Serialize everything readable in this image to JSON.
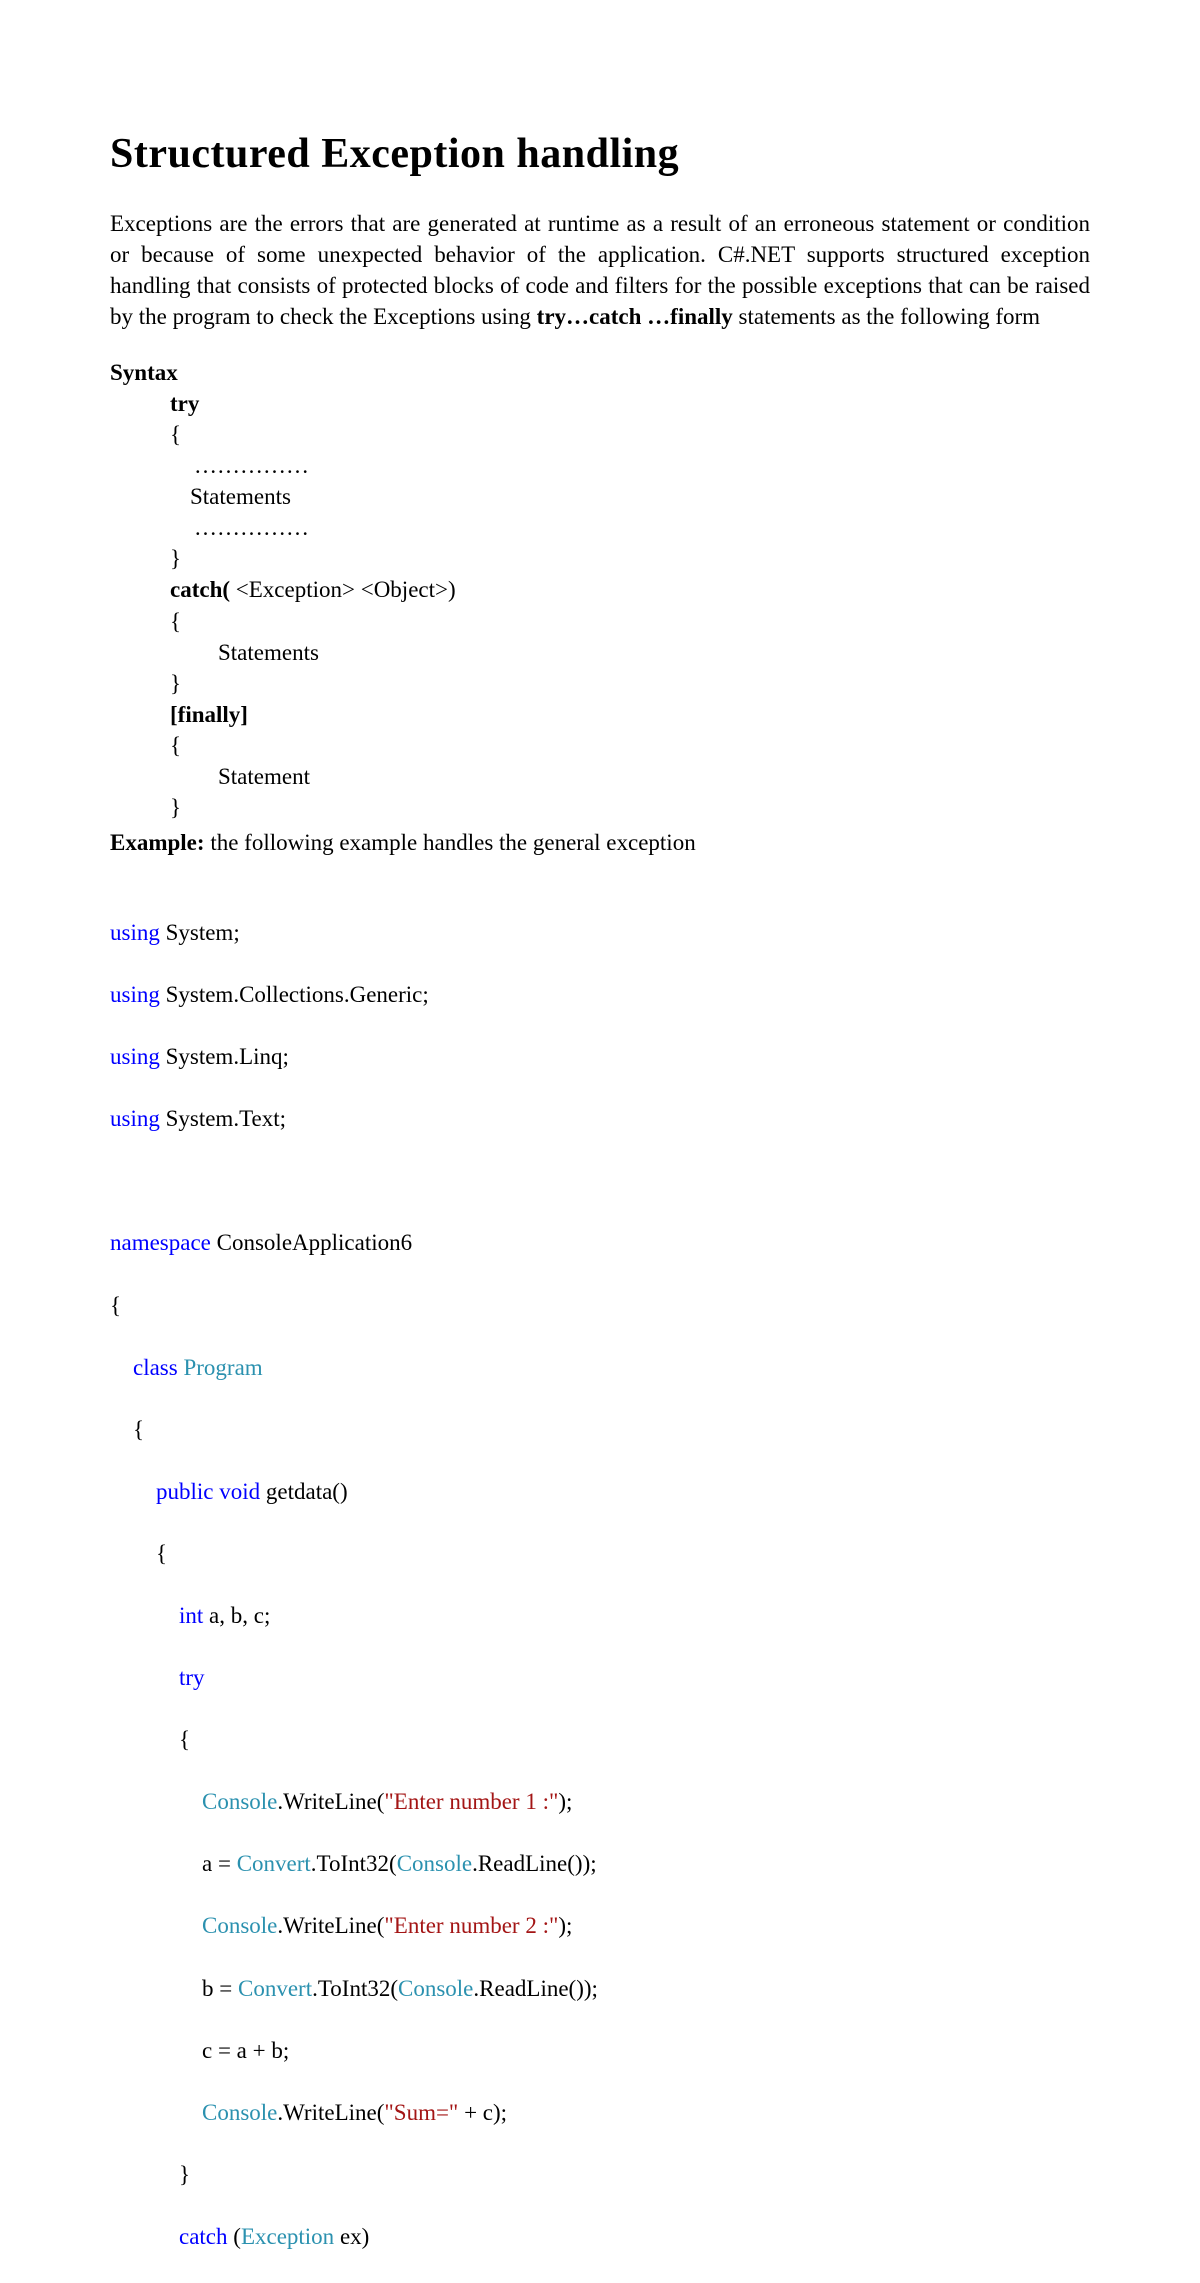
{
  "title": "Structured Exception handling",
  "intro": {
    "part1": "Exceptions are the errors that are generated at runtime as a result of an erroneous statement or condition or because of some unexpected behavior of the application. C#.NET supports structured exception handling that consists of protected blocks of code and filters for the possible exceptions that can be raised by the program to check the Exceptions using  ",
    "bold": "try…catch …finally",
    "part2": " statements as the following form"
  },
  "syntax": {
    "label": "Syntax",
    "try": "try",
    "brace_open": "{",
    "dots1": "……………",
    "stmt1": "Statements",
    "dots2": "……………",
    "brace_close1": " }",
    "catch_kw": "catch(",
    "catch_args": " <Exception>  <Object>)",
    "brace_open2": "{",
    "stmt2": "Statements",
    "brace_close2": "}",
    "finally": "[finally]",
    "brace_open3": "{",
    "stmt3": "Statement",
    "brace_close3": "}"
  },
  "example": {
    "label": "Example:",
    "text": " the following example handles the general exception"
  },
  "code": {
    "l1_kw": "using",
    "l1_txt": " System;",
    "l2_kw": "using",
    "l2_txt": " System.Collections.Generic;",
    "l3_kw": "using",
    "l3_txt": " System.Linq;",
    "l4_kw": "using",
    "l4_txt": " System.Text;",
    "blank": " ",
    "l5_kw": "namespace",
    "l5_txt": " ConsoleApplication6",
    "l6": "{",
    "l7_pad": "    ",
    "l7_kw": "class",
    "l7_cls": " Program",
    "l8": "    {",
    "l9_pad": "        ",
    "l9_kw1": "public",
    "l9_sp": " ",
    "l9_kw2": "void",
    "l9_txt": " getdata()",
    "l10": "        {",
    "l11_pad": "            ",
    "l11_kw": "int",
    "l11_txt": " a, b, c;",
    "l12_pad": "            ",
    "l12_kw": "try",
    "l13": "            {",
    "l14_pad": "                ",
    "l14_cls": "Console",
    "l14_txt1": ".WriteLine(",
    "l14_str": "\"Enter number 1 :\"",
    "l14_txt2": ");",
    "l15_pad": "                a = ",
    "l15_cls1": "Convert",
    "l15_txt1": ".ToInt32(",
    "l15_cls2": "Console",
    "l15_txt2": ".ReadLine());",
    "l16_pad": "                ",
    "l16_cls": "Console",
    "l16_txt1": ".WriteLine(",
    "l16_str": "\"Enter number 2 :\"",
    "l16_txt2": ");",
    "l17_pad": "                b = ",
    "l17_cls1": "Convert",
    "l17_txt1": ".ToInt32(",
    "l17_cls2": "Console",
    "l17_txt2": ".ReadLine());",
    "l18": "                c = a + b;",
    "l19_pad": "                ",
    "l19_cls": "Console",
    "l19_txt1": ".WriteLine(",
    "l19_str": "\"Sum=\"",
    "l19_txt2": " + c);",
    "l20": "            }",
    "l21_pad": "            ",
    "l21_kw": "catch",
    "l21_txt1": " (",
    "l21_cls": "Exception",
    "l21_txt2": " ex)"
  }
}
